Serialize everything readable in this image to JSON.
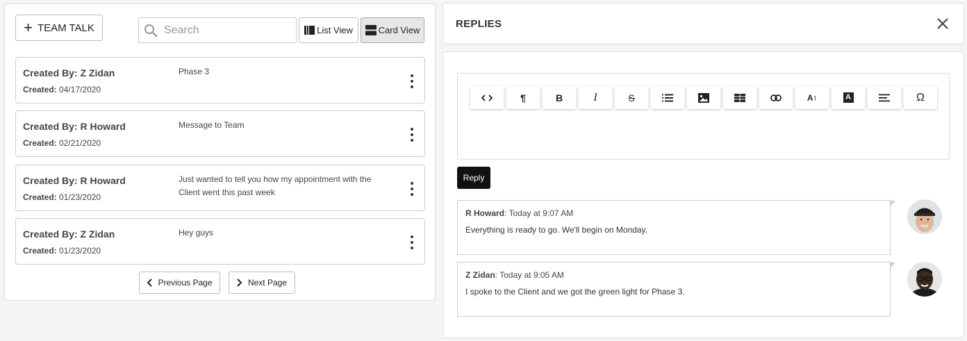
{
  "left": {
    "team_talk_label": "TEAM TALK",
    "search_placeholder": "Search",
    "list_view_label": "List View",
    "card_view_label": "Card View",
    "cards": [
      {
        "created_by": "Created By: Z Zidan",
        "created_label": "Created:",
        "created_date": "04/17/2020",
        "message": "Phase 3"
      },
      {
        "created_by": "Created By: R Howard",
        "created_label": "Created:",
        "created_date": "02/21/2020",
        "message": "Message to Team"
      },
      {
        "created_by": "Created By: R Howard",
        "created_label": "Created:",
        "created_date": "01/23/2020",
        "message": "Just wanted to tell you how my appointment with the Client went this past week"
      },
      {
        "created_by": "Created By: Z Zidan",
        "created_label": "Created:",
        "created_date": "01/23/2020",
        "message": "Hey guys"
      }
    ],
    "prev_label": "Previous Page",
    "next_label": "Next Page"
  },
  "right": {
    "title": "REPLIES",
    "toolbar": [
      {
        "icon": "code-view-icon",
        "glyph": "<>"
      },
      {
        "icon": "paragraph-icon",
        "glyph": "¶"
      },
      {
        "icon": "bold-icon",
        "glyph": "B"
      },
      {
        "icon": "italic-icon",
        "glyph": "I"
      },
      {
        "icon": "strikethrough-icon",
        "glyph": "S"
      },
      {
        "icon": "bullet-list-icon",
        "glyph": ""
      },
      {
        "icon": "image-icon",
        "glyph": ""
      },
      {
        "icon": "table-icon",
        "glyph": ""
      },
      {
        "icon": "link-icon",
        "glyph": ""
      },
      {
        "icon": "font-size-icon",
        "glyph": "A↕"
      },
      {
        "icon": "font-color-icon",
        "glyph": "A"
      },
      {
        "icon": "align-icon",
        "glyph": ""
      },
      {
        "icon": "special-char-icon",
        "glyph": "Ω"
      }
    ],
    "reply_label": "Reply",
    "comments": [
      {
        "author": "R Howard",
        "time": ": Today at 9:07 AM",
        "text": "Everything is ready to go. We'll begin on Monday."
      },
      {
        "author": "Z Zidan",
        "time": ": Today at 9:05 AM",
        "text": "I spoke to the Client and we got the green light for Phase 3."
      }
    ]
  },
  "colors": {
    "reply_button": "#111111",
    "card_view_active": "#e6e6e6",
    "border": "#cccccc"
  }
}
